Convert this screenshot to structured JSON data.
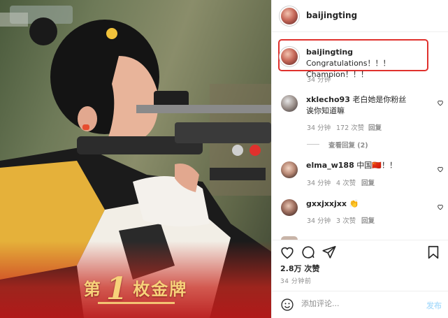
{
  "photo": {
    "medal_prefix": "第",
    "medal_number": "1",
    "medal_suffix": "枚金牌",
    "overlay_color": "#c8281e",
    "text_color": "#f7d27a"
  },
  "header": {
    "username": "baijingting"
  },
  "caption": {
    "username": "baijingting",
    "text": "Congratulations！！！Champion！！！",
    "time": "34 分钟",
    "highlight_color": "#e0312d"
  },
  "comments": [
    {
      "username": "xklecho93",
      "text": "老白她是你粉丝诶你知道嘛",
      "time": "34 分钟",
      "likes": "172 次赞",
      "reply": "回复",
      "view_replies": "查看回复 (2)",
      "heart_icon": "heart-outline-icon"
    },
    {
      "username": "elma_w188",
      "text": "中国🇨🇳！！",
      "time": "34 分钟",
      "likes": "4 次赞",
      "reply": "回复",
      "heart_icon": "heart-outline-icon"
    },
    {
      "username": "gxxjxxjxx",
      "text": "👏",
      "time": "34 分钟",
      "likes": "3 次赞",
      "reply": "回复",
      "heart_icon": "heart-outline-icon"
    }
  ],
  "more_icon": "more-dots-icon",
  "actions": {
    "icons": [
      "heart-icon",
      "comment-icon",
      "share-icon",
      "bookmark-icon"
    ],
    "likes": "2.8万 次赞",
    "posted": "34 分钟前"
  },
  "add_comment": {
    "placeholder": "添加评论...",
    "post_label": "发布",
    "emoji_icon": "emoji-icon"
  }
}
